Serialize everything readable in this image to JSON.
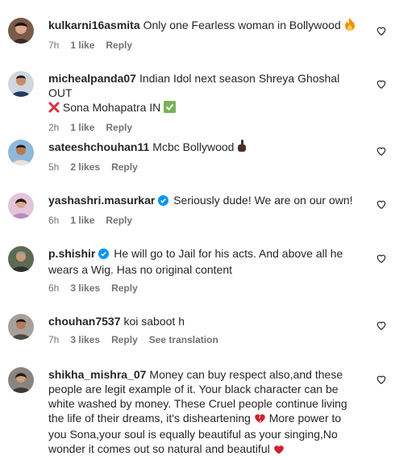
{
  "colors": {
    "text": "#262626",
    "meta": "#737373",
    "verified": "#0095f6",
    "heart_emoji": "#d1202f"
  },
  "comments": [
    {
      "username": "kulkarni16asmita",
      "text": "Only one Fearless woman in Bollywood",
      "trailing_emoji": "fire-emoji",
      "time": "7h",
      "likes": "1 like",
      "reply": "Reply"
    },
    {
      "username": "michealpanda07",
      "text_part1": "Indian Idol next season Shreya Ghoshal OUT",
      "text_part2": "Sona Mohapatra IN",
      "emoji1": "cross-mark-emoji",
      "emoji2": "check-mark-emoji",
      "time": "2h",
      "likes": "1 like",
      "reply": "Reply"
    },
    {
      "username": "sateeshchouhan11",
      "text": "Mcbc Bollywood",
      "trailing_emoji": "middle-finger-emoji",
      "time": "5h",
      "likes": "2 likes",
      "reply": "Reply"
    },
    {
      "username": "yashashri.masurkar",
      "verified": true,
      "text": "Seriously dude! We are on our own!",
      "time": "6h",
      "likes": "1 like",
      "reply": "Reply"
    },
    {
      "username": "p.shishir",
      "verified": true,
      "text": "He will go to Jail for his acts. And above all he wears a Wig. Has no original content",
      "time": "6h",
      "likes": "3 likes",
      "reply": "Reply"
    },
    {
      "username": "chouhan7537",
      "text": "koi saboot h",
      "time": "7h",
      "likes": "3 likes",
      "reply": "Reply",
      "translation": "See translation"
    },
    {
      "username": "shikha_mishra_07",
      "text_part1": "Money can buy respect also,and these people are legit example of it. Your black character can be white washed by money. These Cruel people continue living the life of their dreams, it's disheartening",
      "text_part2": "More power to you Sona,your soul is equally beautiful as your singing,No wonder it comes out so natural and beautiful",
      "emoji": "broken-heart-emoji",
      "trailing_emoji": "red-heart-emoji",
      "time": "",
      "likes": "",
      "reply": ""
    }
  ]
}
